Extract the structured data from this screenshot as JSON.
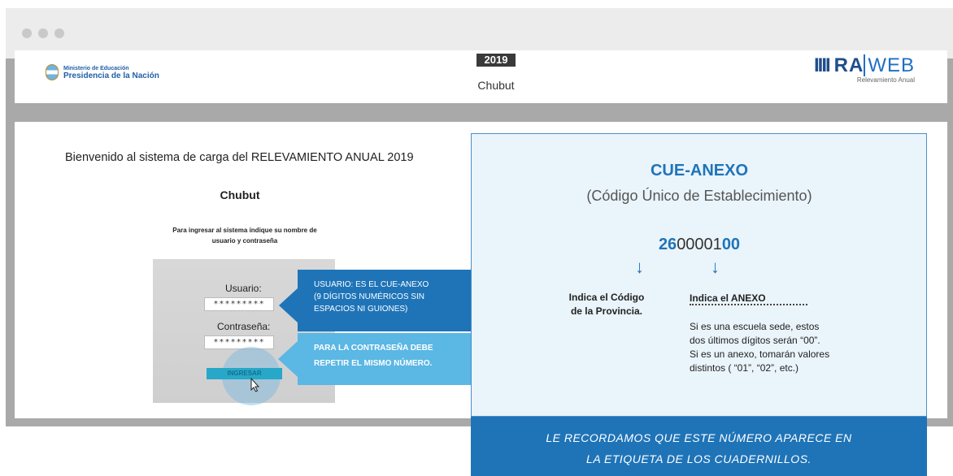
{
  "header": {
    "ministry_small": "Ministerio de Educación",
    "ministry_big": "Presidencia de la Nación",
    "year": "2019",
    "province": "Chubut",
    "brand_bars": "IIII",
    "brand_ra": "RA",
    "brand_web": "WEB",
    "brand_sub": "Relevamiento Anual"
  },
  "login": {
    "welcome": "Bienvenido al sistema de carga del RELEVAMIENTO ANUAL 2019",
    "province_title": "Chubut",
    "instruction_line1": "Para ingresar al sistema indique su nombre de",
    "instruction_line2": "usuario y contraseña",
    "user_label": "Usuario:",
    "user_value": "*********",
    "password_label": "Contraseña:",
    "password_value": "*********",
    "submit_label": "INGRESAR"
  },
  "callouts": {
    "user_line1": "USUARIO: ES EL CUE-ANEXO",
    "user_line2": "(9 DÍGITOS NUMÉRICOS SIN",
    "user_line3": "ESPACIOS NI GUIONES)",
    "password_line1": "PARA LA CONTRASEÑA DEBE",
    "password_line2": "REPETIR EL MISMO NÚMERO."
  },
  "cue_panel": {
    "title": "CUE-ANEXO",
    "subtitle": "(Código Único de Establecimiento)",
    "code_prefix": "26",
    "code_middle": "00001",
    "code_suffix": "00",
    "province_desc_line1": "Indica el Código",
    "province_desc_line2": "de la Provincia.",
    "anexo_heading": "Indica el ANEXO",
    "anexo_line1": "Si es una escuela sede, estos",
    "anexo_line2": "dos últimos dígitos serán “00”.",
    "anexo_line3": "Si es un anexo, tomarán valores",
    "anexo_line4": "distintos ( “01”, “02”, etc.)"
  },
  "footer": {
    "line1": "LE RECORDAMOS QUE ESTE NÚMERO APARECE EN",
    "line2": "LA ETIQUETA DE LOS CUADERNILLOS."
  },
  "colors": {
    "accent_blue": "#1f74b8",
    "light_blue": "#5bb7e4",
    "panel_bg": "#eaf4fb",
    "login_button": "#27a8c9"
  },
  "icons": [
    "window-dot-icon",
    "argentina-emblem-icon",
    "down-arrow-icon",
    "mouse-cursor-icon"
  ]
}
